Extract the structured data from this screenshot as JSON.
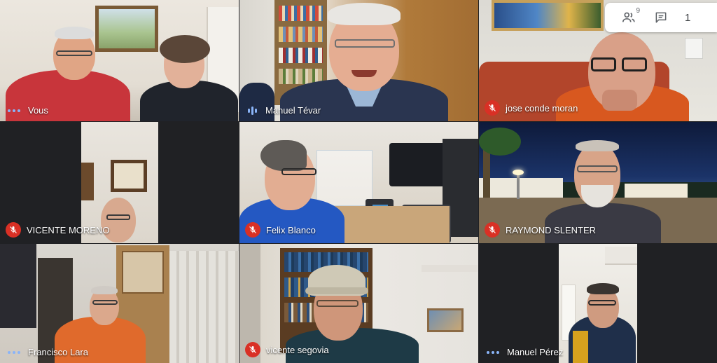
{
  "participants": [
    {
      "name": "Vous",
      "audio": "idle"
    },
    {
      "name": "Manuel Tévar",
      "audio": "speaking"
    },
    {
      "name": "jose conde moran",
      "audio": "muted"
    },
    {
      "name": "VICENTE MORENO",
      "audio": "muted"
    },
    {
      "name": "Felix Blanco",
      "audio": "muted"
    },
    {
      "name": "RAYMOND SLENTER",
      "audio": "muted"
    },
    {
      "name": "Francisco Lara",
      "audio": "idle"
    },
    {
      "name": "vicente segovia",
      "audio": "muted"
    },
    {
      "name": "Manuel Pérez",
      "audio": "idle"
    }
  ],
  "toolbar": {
    "people_count": "9",
    "people_icon": "people-icon",
    "chat_icon": "chat-icon",
    "cut_text": "1"
  },
  "colors": {
    "muted_red": "#d93025",
    "active_blue": "#8ab4f8",
    "background": "#202124"
  }
}
